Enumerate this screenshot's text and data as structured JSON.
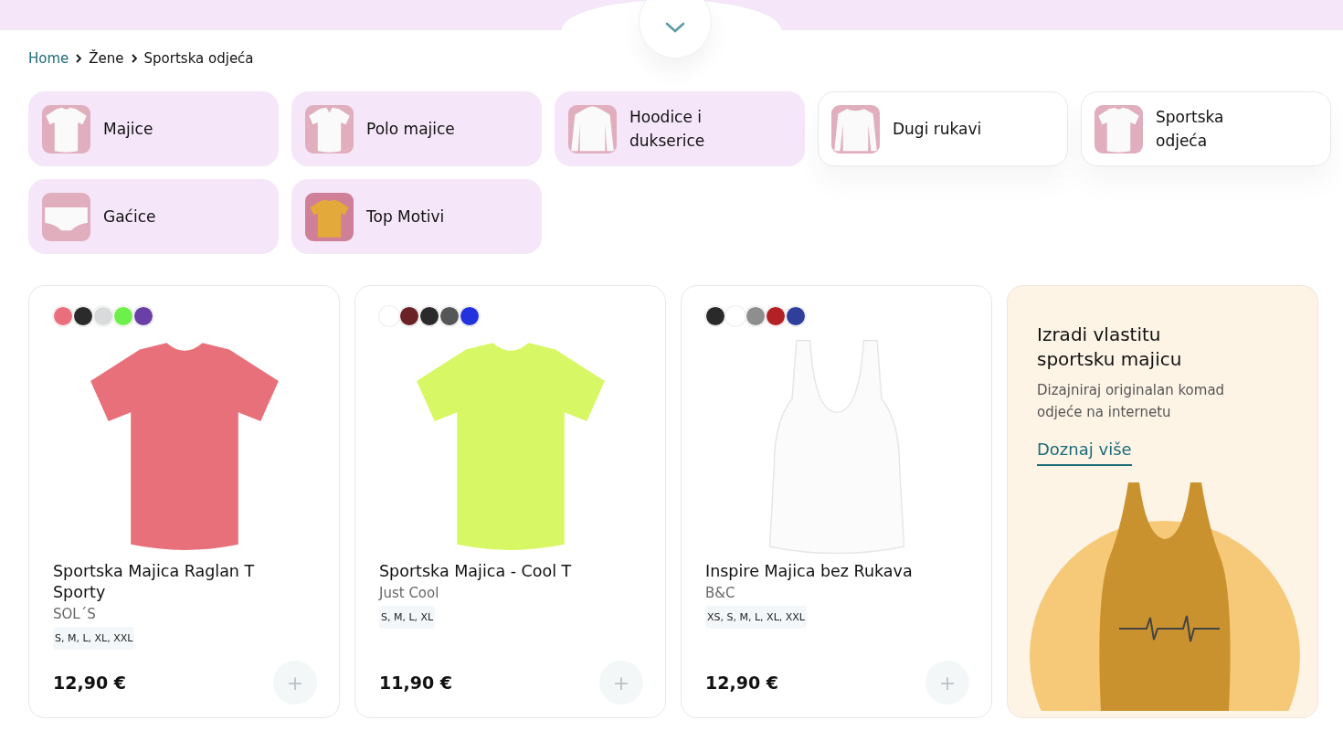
{
  "breadcrumb": [
    {
      "label": "Home",
      "link": true
    },
    {
      "label": "Žene",
      "link": false
    },
    {
      "label": "Sportska odjeća",
      "link": false
    }
  ],
  "categories": [
    {
      "label": "Majice",
      "highlighted": false
    },
    {
      "label": "Polo majice",
      "highlighted": false
    },
    {
      "label": "Hoodice i dukserice",
      "highlighted": false
    },
    {
      "label": "Dugi rukavi",
      "highlighted": true
    },
    {
      "label": "Sportska odjeća",
      "highlighted": true
    },
    {
      "label": "Gaćice",
      "highlighted": false
    },
    {
      "label": "Top Motivi",
      "highlighted": false
    }
  ],
  "products": [
    {
      "name": "Sportska Majica Raglan T Sporty",
      "brand": "SOL´S",
      "sizes": "S, M, L, XL, XXL",
      "price": "12,90 €",
      "add_label": "+",
      "swatches": [
        {
          "color": "#ea6f7c"
        },
        {
          "color": "#2b2b2b"
        },
        {
          "color": "#d8dadb"
        },
        {
          "color": "#6ef04a"
        },
        {
          "color": "#6a3fa8"
        }
      ]
    },
    {
      "name": "Sportska Majica - Cool T",
      "brand": "Just Cool",
      "sizes": "S, M, L, XL",
      "price": "11,90 €",
      "add_label": "+",
      "swatches": [
        {
          "color": "#ffffff"
        },
        {
          "color": "#6a2226"
        },
        {
          "color": "#2b2b2e"
        },
        {
          "color": "#555756"
        },
        {
          "color": "#2233dd"
        }
      ]
    },
    {
      "name": "Inspire Majica bez Rukava",
      "brand": "B&C",
      "sizes": "XS, S, M, L, XL, XXL",
      "price": "12,90 €",
      "add_label": "+",
      "swatches": [
        {
          "color": "#2a2a2a"
        },
        {
          "color": "#ffffff"
        },
        {
          "color": "#8e8e8e"
        },
        {
          "color": "#b32025"
        },
        {
          "color": "#2f3f9a"
        }
      ]
    }
  ],
  "promo": {
    "title": "Izradi vlastitu sportsku majicu",
    "text": "Dizajniraj originalan komad odjeće na internetu",
    "link": "Doznaj više"
  }
}
